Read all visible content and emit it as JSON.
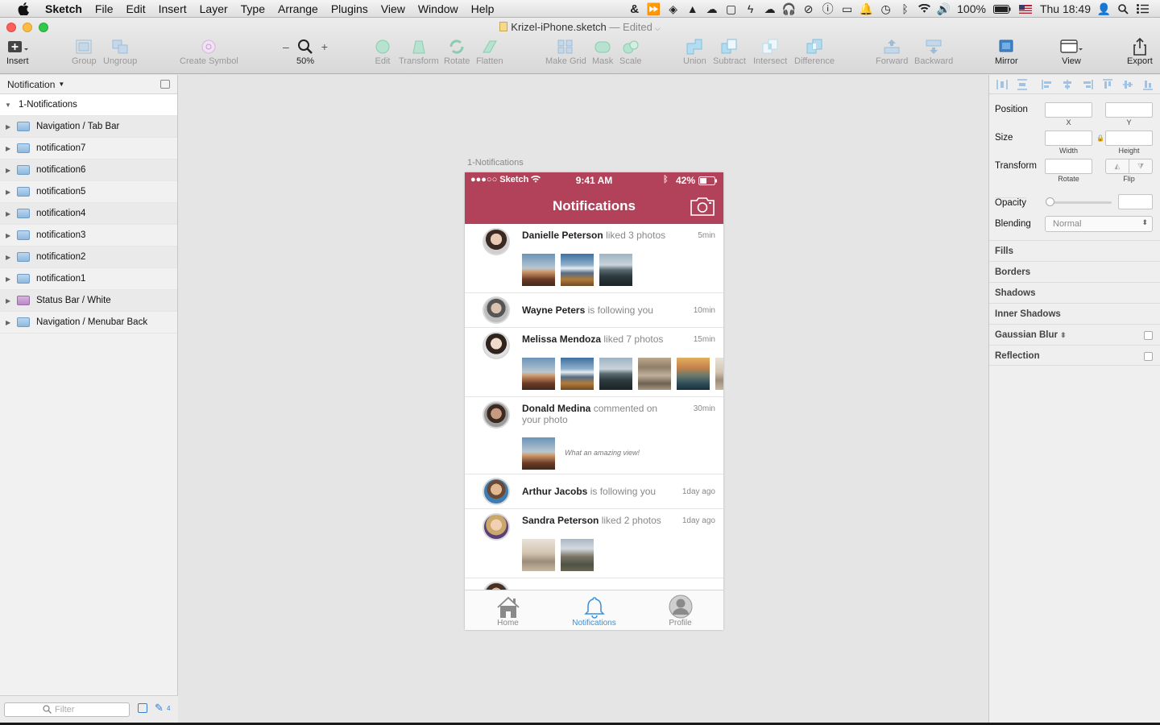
{
  "menubar": {
    "app": "Sketch",
    "items": [
      "File",
      "Edit",
      "Insert",
      "Layer",
      "Type",
      "Arrange",
      "Plugins",
      "View",
      "Window",
      "Help"
    ],
    "battery": "100%",
    "clock": "Thu 18:49"
  },
  "window": {
    "doc_title": "Krizel-iPhone.sketch",
    "edited": "— Edited"
  },
  "toolbar": {
    "insert": "Insert",
    "group": "Group",
    "ungroup": "Ungroup",
    "create_symbol": "Create Symbol",
    "zoom_minus": "–",
    "zoom_plus": "+",
    "zoom": "50%",
    "edit": "Edit",
    "transform": "Transform",
    "rotate": "Rotate",
    "flatten": "Flatten",
    "make_grid": "Make Grid",
    "mask": "Mask",
    "scale": "Scale",
    "union": "Union",
    "subtract": "Subtract",
    "intersect": "Intersect",
    "difference": "Difference",
    "forward": "Forward",
    "backward": "Backward",
    "mirror": "Mirror",
    "view": "View",
    "export": "Export"
  },
  "layers": {
    "page": "Notification",
    "artboard": "1-Notifications",
    "items": [
      {
        "name": "Navigation / Tab Bar",
        "color": "blue"
      },
      {
        "name": "notification7",
        "color": "blue"
      },
      {
        "name": "notification6",
        "color": "blue"
      },
      {
        "name": "notification5",
        "color": "blue"
      },
      {
        "name": "notification4",
        "color": "blue"
      },
      {
        "name": "notification3",
        "color": "blue"
      },
      {
        "name": "notification2",
        "color": "blue"
      },
      {
        "name": "notification1",
        "color": "blue"
      },
      {
        "name": "Status Bar / White",
        "color": "pink"
      },
      {
        "name": "Navigation / Menubar Back",
        "color": "blue"
      }
    ],
    "filter_placeholder": "Filter",
    "count": "4"
  },
  "artboard": {
    "label": "1-Notifications"
  },
  "phone": {
    "carrier": "●●●○○ Sketch",
    "time": "9:41 AM",
    "battery": "42%",
    "title": "Notifications",
    "notifications": [
      {
        "name": "Danielle Peterson",
        "action": "liked 3 photos",
        "time": "5min"
      },
      {
        "name": "Wayne Peters",
        "action": "is following you",
        "time": "10min"
      },
      {
        "name": "Melissa Mendoza",
        "action": "liked 7 photos",
        "time": "15min"
      },
      {
        "name": "Donald Medina",
        "action": "commented on your photo",
        "time": "30min",
        "comment": "What an amazing view!"
      },
      {
        "name": "Arthur Jacobs",
        "action": "is following you",
        "time": "1day ago"
      },
      {
        "name": "Sandra Peterson",
        "action": "liked 2 photos",
        "time": "1day ago"
      }
    ],
    "tabs": [
      "Home",
      "Notifications",
      "Profile"
    ]
  },
  "inspector": {
    "position": "Position",
    "x": "X",
    "y": "Y",
    "size": "Size",
    "width": "Width",
    "height": "Height",
    "transform": "Transform",
    "rotate": "Rotate",
    "flip": "Flip",
    "opacity": "Opacity",
    "blending": "Blending",
    "blending_value": "Normal",
    "fills": "Fills",
    "borders": "Borders",
    "shadows": "Shadows",
    "inner_shadows": "Inner Shadows",
    "gaussian_blur": "Gaussian Blur",
    "reflection": "Reflection"
  },
  "colors": {
    "accent": "#b24259",
    "tab_active": "#3b8fd9"
  }
}
